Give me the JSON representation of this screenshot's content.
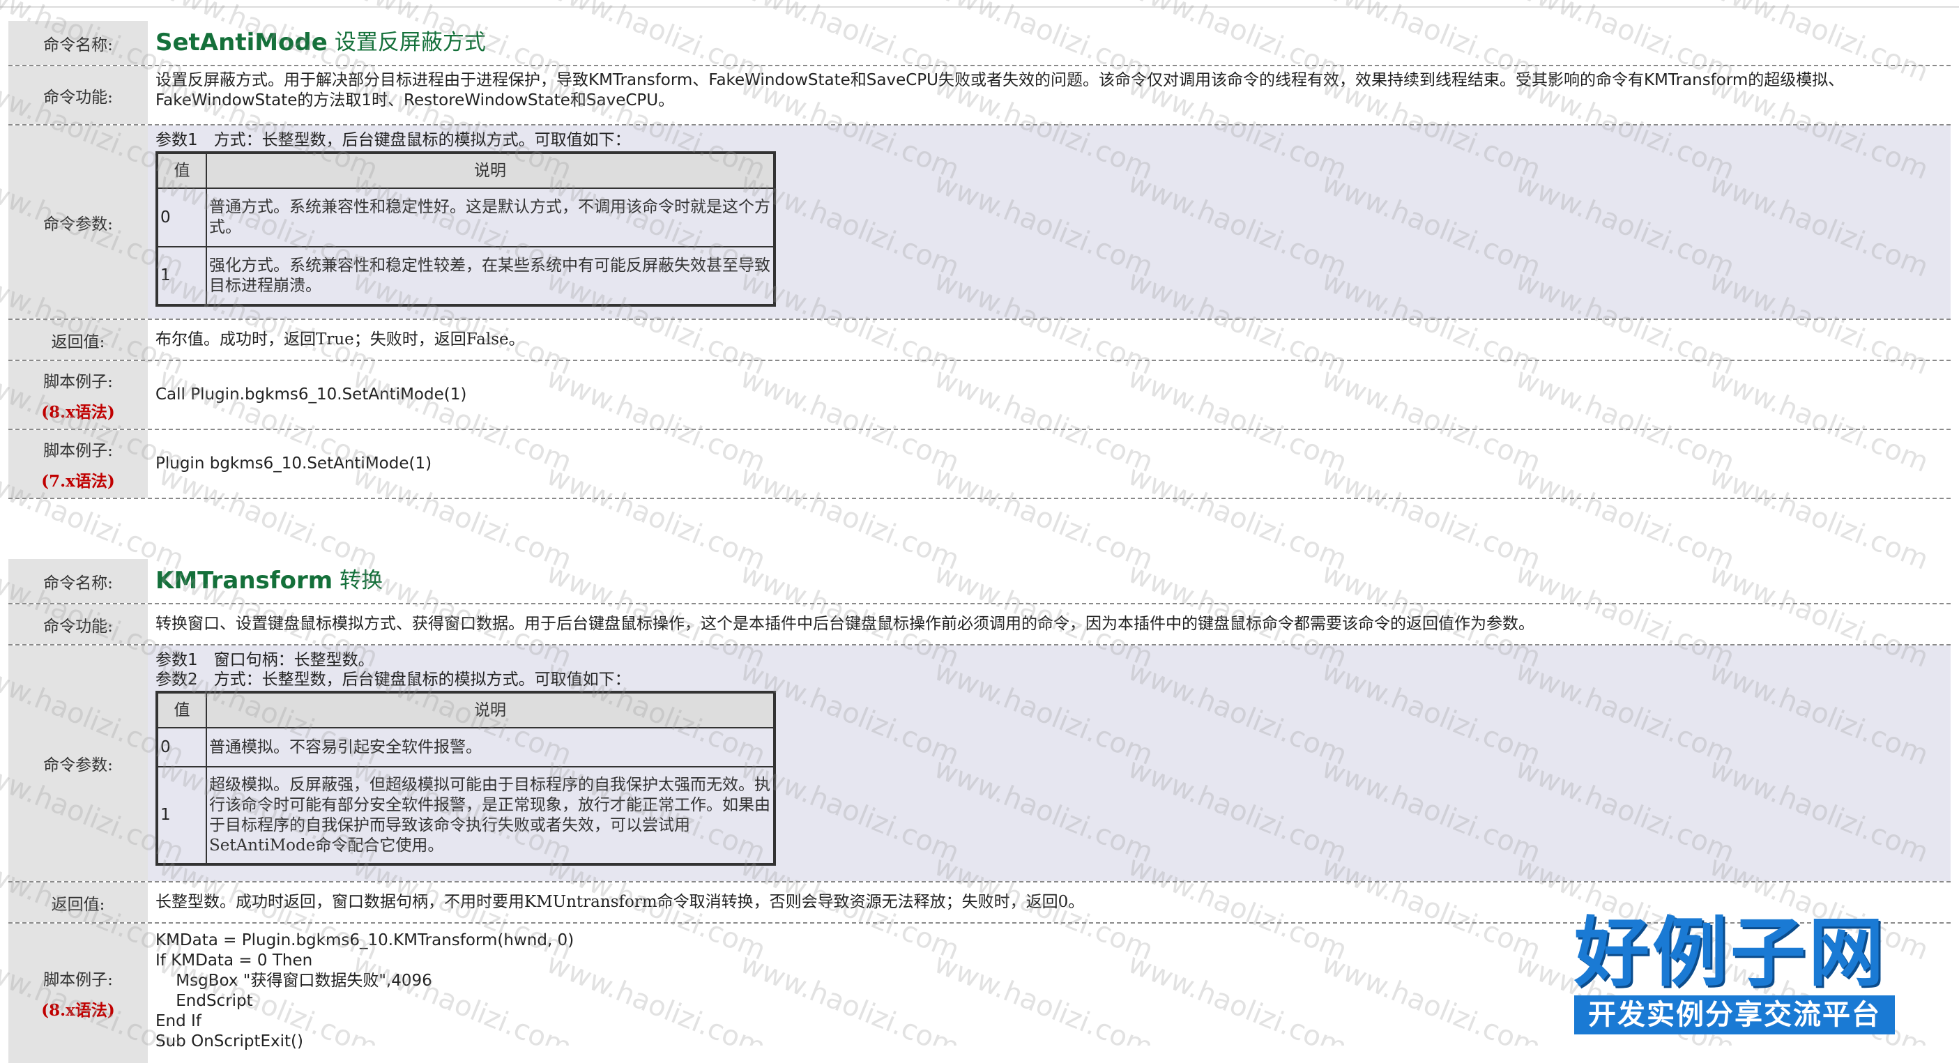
{
  "labels": {
    "name": "命令名称:",
    "function": "命令功能:",
    "params": "命令参数:",
    "return": "返回值:",
    "example": "脚本例子:",
    "syntax8": "(8.x语法)",
    "syntax7": "(7.x语法)"
  },
  "table_headers": {
    "value": "值",
    "desc": "说明"
  },
  "cmd1": {
    "name": "SetAntiMode",
    "subtitle": "设置反屏蔽方式",
    "function": "设置反屏蔽方式。用于解决部分目标进程由于进程保护，导致KMTransform、FakeWindowState和SaveCPU失败或者失效的问题。该命令仅对调用该命令的线程有效，效果持续到线程结束。受其影响的命令有KMTransform的超级模拟、FakeWindowState的方法取1时、RestoreWindowState和SaveCPU。",
    "param1": "参数1　方式：长整型数，后台键盘鼠标的模拟方式。可取值如下：",
    "rows": [
      {
        "value": "0",
        "desc": "普通方式。系统兼容性和稳定性好。这是默认方式，不调用该命令时就是这个方式。"
      },
      {
        "value": "1",
        "desc": "强化方式。系统兼容性和稳定性较差，在某些系统中有可能反屏蔽失效甚至导致目标进程崩溃。"
      }
    ],
    "return": "布尔值。成功时，返回True；失败时，返回False。",
    "example8": "Call Plugin.bgkms6_10.SetAntiMode(1)",
    "example7": "Plugin bgkms6_10.SetAntiMode(1)"
  },
  "cmd2": {
    "name": "KMTransform",
    "subtitle": "转换",
    "function": "转换窗口、设置键盘鼠标模拟方式、获得窗口数据。用于后台键盘鼠标操作，这个是本插件中后台键盘鼠标操作前必须调用的命令，因为本插件中的键盘鼠标命令都需要该命令的返回值作为参数。",
    "param1": "参数1　窗口句柄：长整型数。",
    "param2": "参数2　方式：长整型数，后台键盘鼠标的模拟方式。可取值如下：",
    "rows": [
      {
        "value": "0",
        "desc": "普通模拟。不容易引起安全软件报警。"
      },
      {
        "value": "1",
        "desc": "超级模拟。反屏蔽强，但超级模拟可能由于目标程序的自我保护太强而无效。执行该命令时可能有部分安全软件报警，是正常现象，放行才能正常工作。如果由于目标程序的自我保护而导致该命令执行失败或者失效，可以尝试用SetAntiMode命令配合它使用。"
      }
    ],
    "return": "长整型数。成功时返回，窗口数据句柄，不用时要用KMUntransform命令取消转换，否则会导致资源无法释放；失败时，返回0。",
    "example8_lines": [
      "KMData = Plugin.bgkms6_10.KMTransform(hwnd, 0)",
      "If KMData = 0 Then",
      "    MsgBox \"获得窗口数据失败\",4096",
      "    EndScript",
      "End If",
      "Sub OnScriptExit()"
    ]
  },
  "watermark": "www.haolizi.com",
  "logo": {
    "main": "好例子网",
    "sub": "开发实例分享交流平台"
  }
}
